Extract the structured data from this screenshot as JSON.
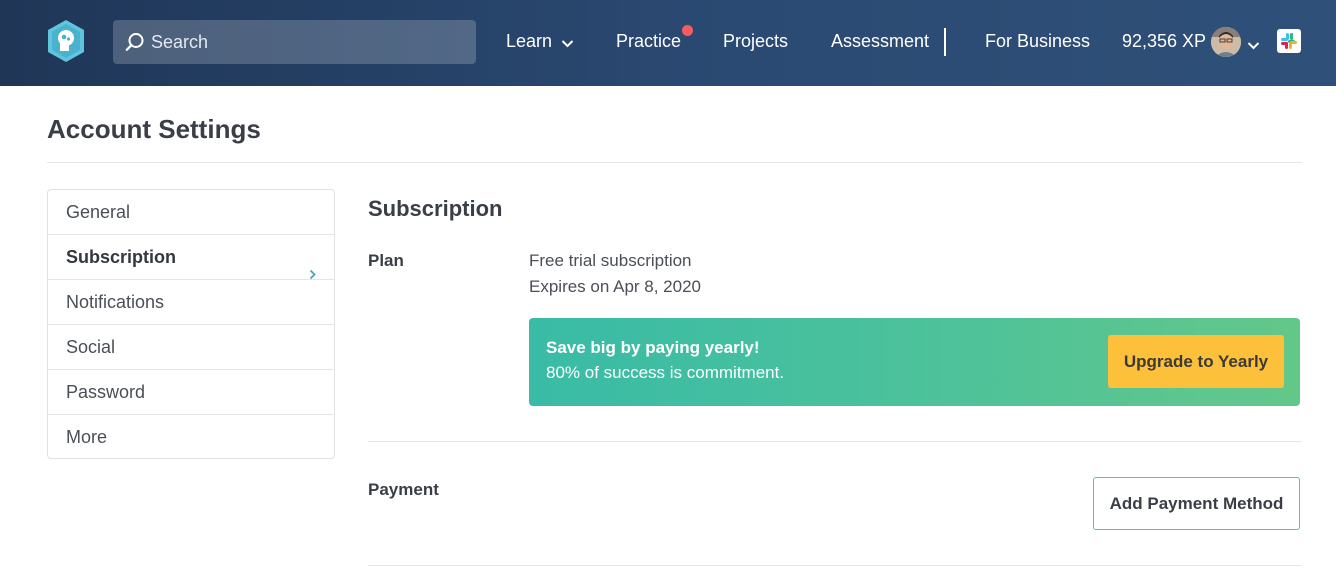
{
  "nav": {
    "search_placeholder": "Search",
    "learn": "Learn",
    "practice": "Practice",
    "projects": "Projects",
    "assessment": "Assessment",
    "for_business": "For Business",
    "xp": "92,356 XP"
  },
  "icons": {
    "logo": "treehouse-logo-icon",
    "search": "search-icon",
    "learn_dropdown": "chevron-down-icon",
    "practice_notification": "notification-dot-icon",
    "avatar": "user-avatar",
    "avatar_dropdown": "chevron-down-icon",
    "slack": "slack-icon",
    "sidebar_active": "chevron-right-icon"
  },
  "page": {
    "title": "Account Settings"
  },
  "sidebar": {
    "items": [
      {
        "label": "General"
      },
      {
        "label": "Subscription"
      },
      {
        "label": "Notifications"
      },
      {
        "label": "Social"
      },
      {
        "label": "Password"
      },
      {
        "label": "More"
      }
    ]
  },
  "subscription": {
    "title": "Subscription",
    "plan_label": "Plan",
    "plan_name": "Free trial subscription",
    "plan_expiry": "Expires on Apr 8, 2020",
    "banner_title": "Save big by paying yearly!",
    "banner_subtitle": "80% of success is commitment.",
    "upgrade_button": "Upgrade to Yearly",
    "payment_label": "Payment",
    "add_payment_button": "Add Payment Method"
  },
  "colors": {
    "nav_background": "#1f3657",
    "notification_dot": "#f55d63",
    "banner_start": "#39bba6",
    "banner_end": "#64c78a",
    "upgrade_button": "#fcc03b",
    "accent": "#5fb8c4"
  }
}
